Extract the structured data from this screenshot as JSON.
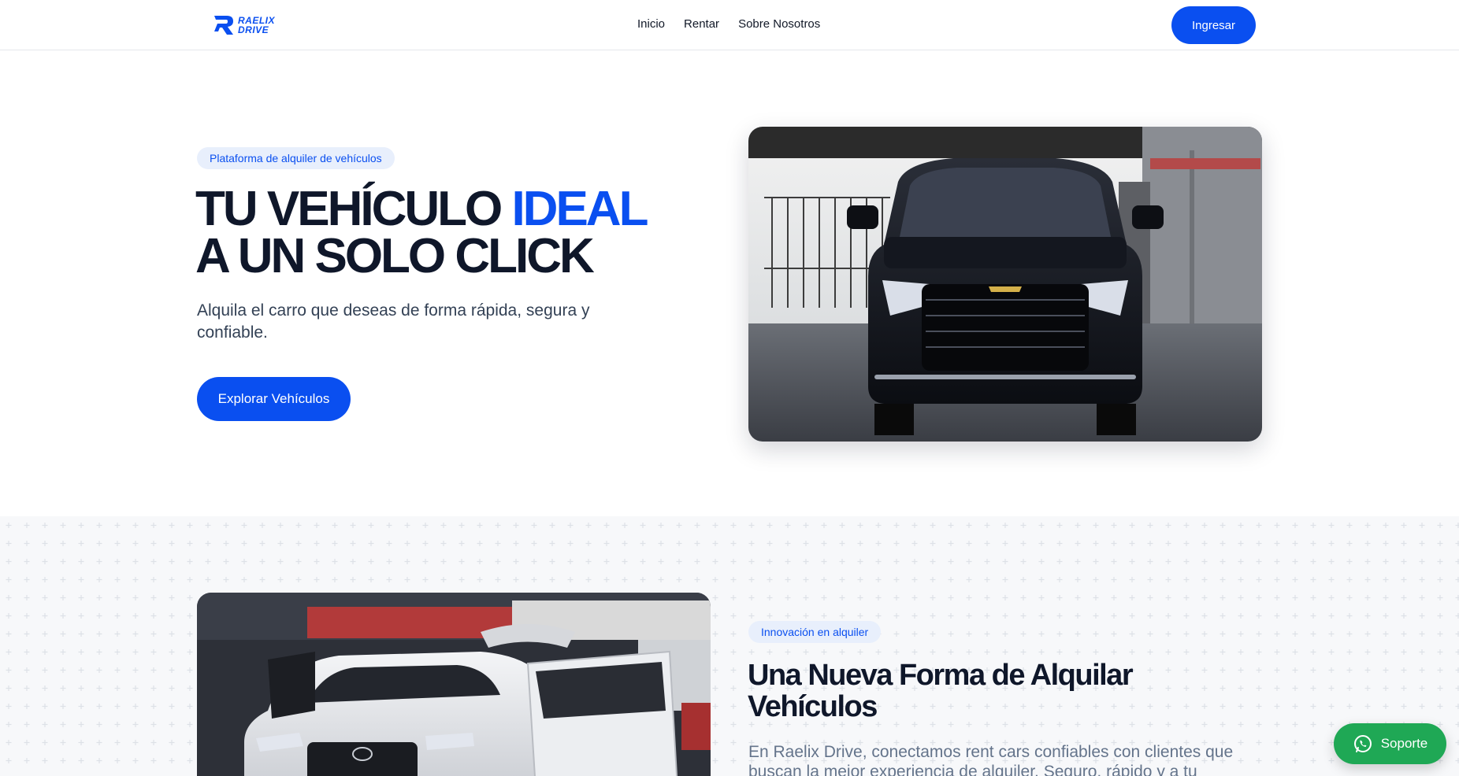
{
  "brand": {
    "line1": "RAELIX",
    "line2": "DRIVE",
    "icon": "raelix-r-logo-icon"
  },
  "nav": {
    "items": [
      {
        "label": "Inicio"
      },
      {
        "label": "Rentar"
      },
      {
        "label": "Sobre Nosotros"
      }
    ],
    "login_label": "Ingresar"
  },
  "hero": {
    "badge": "Plataforma de alquiler de vehículos",
    "title_part1": "TU VEHÍCULO ",
    "title_highlight": "IDEAL",
    "title_part2": " A UN SOLO CLICK",
    "description": "Alquila el carro que deseas de forma rápida, segura y confiable.",
    "cta_label": "Explorar Vehículos"
  },
  "about": {
    "badge": "Innovación en alquiler",
    "title": "Una Nueva Forma de Alquilar Vehículos",
    "description": "En Raelix Drive, conectamos rent cars confiables con clientes que buscan la mejor experiencia de alquiler. Seguro, rápido y a tu"
  },
  "support": {
    "label": "Soporte",
    "icon": "whatsapp-icon"
  },
  "colors": {
    "accent": "#0a4ff0",
    "badge_bg": "#e8effc",
    "whatsapp": "#1fa855",
    "dark_text": "#0f172a"
  }
}
